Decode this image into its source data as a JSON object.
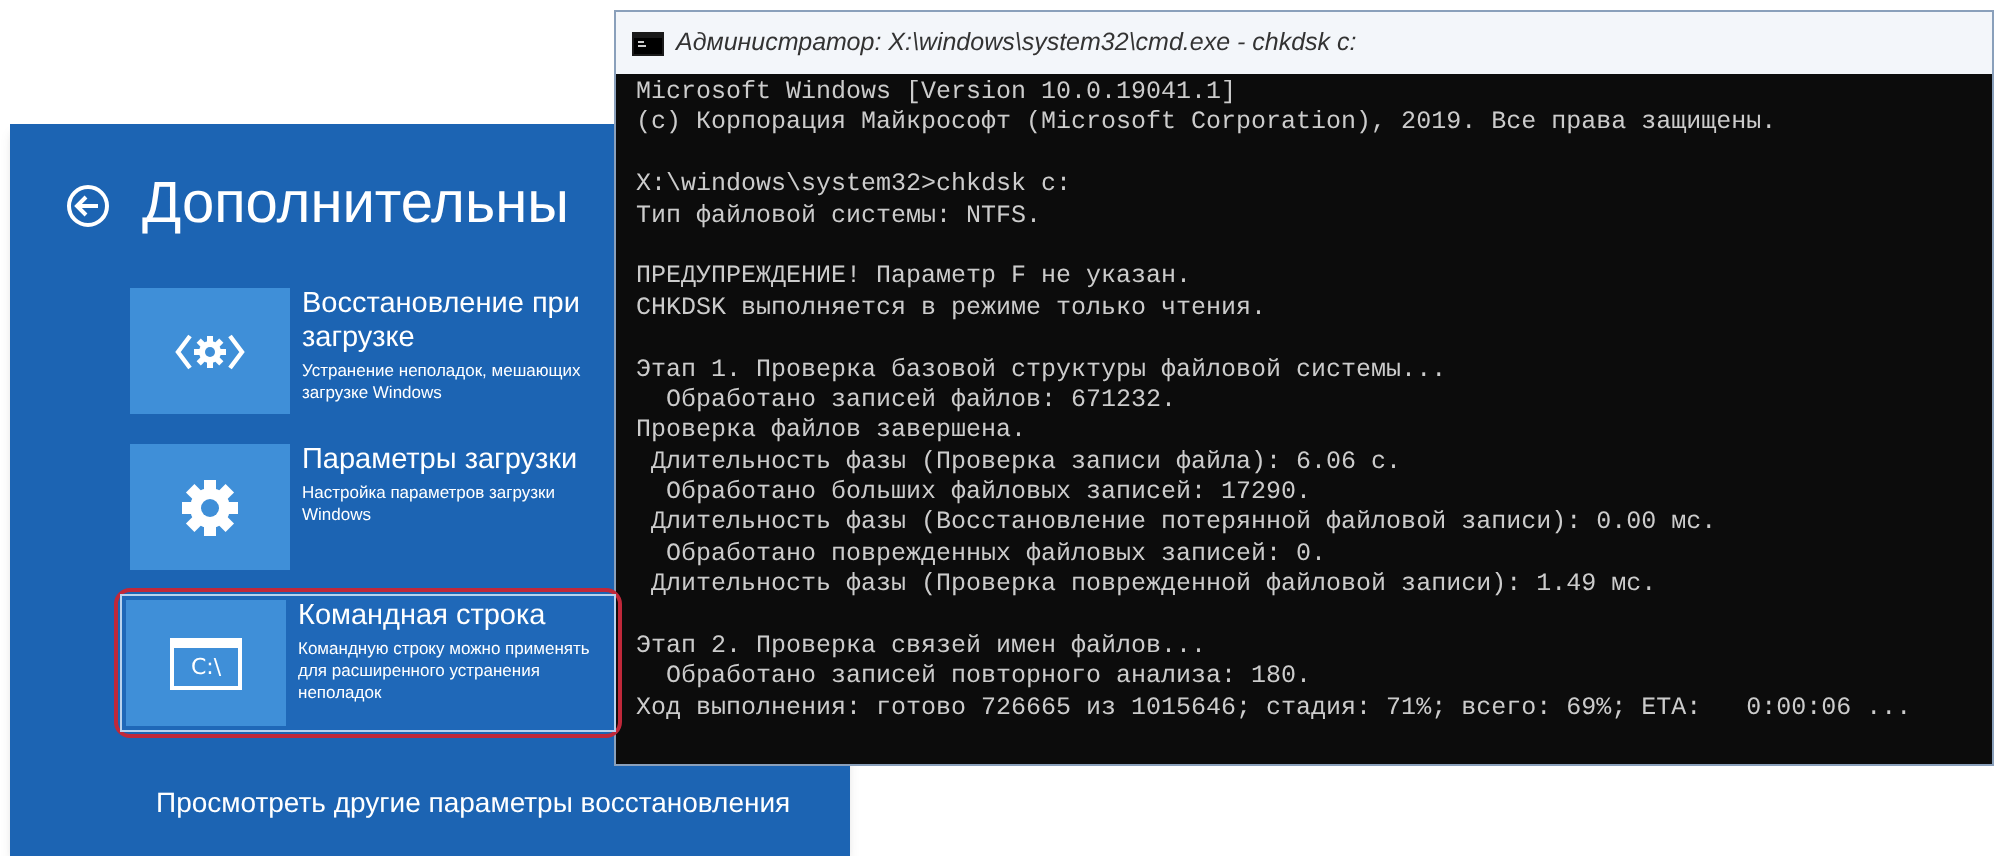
{
  "recovery_panel": {
    "heading": "Дополнительны",
    "options": [
      {
        "kind": "startup-repair",
        "title": "Восстановление при загрузке",
        "description": "Устранение неполадок, мешающих загрузке Windows",
        "selected": false
      },
      {
        "kind": "settings",
        "title": "Параметры загрузки",
        "description": "Настройка параметров загрузки Windows",
        "selected": false
      },
      {
        "kind": "command-prompt",
        "icon_label": "C:\\",
        "title": "Командная строка",
        "description": "Командную строку можно применять для расширенного устранения неполадок",
        "selected": true
      }
    ],
    "link": "Просмотреть другие параметры восстановления"
  },
  "console_window": {
    "title": "Администратор: X:\\windows\\system32\\cmd.exe - chkdsk  c:",
    "blocks": [
      [
        "Microsoft Windows [Version 10.0.19041.1]",
        "(c) Корпорация Майкрософт (Microsoft Corporation), 2019. Все права защищены."
      ],
      [
        "X:\\windows\\system32>chkdsk c:",
        "Тип файловой системы: NTFS."
      ],
      [
        "ПРЕДУПРЕЖДЕНИЕ! Параметр F не указан.",
        "CHKDSK выполняется в режиме только чтения."
      ],
      [
        "Этап 1. Проверка базовой структуры файловой системы...",
        "  Обработано записей файлов: 671232.",
        "Проверка файлов завершена.",
        " Длительность фазы (Проверка записи файла): 6.06 с.",
        "  Обработано больших файловых записей: 17290.",
        " Длительность фазы (Восстановление потерянной файловой записи): 0.00 мс.",
        "  Обработано поврежденных файловых записей: 0.",
        " Длительность фазы (Проверка поврежденной файловой записи): 1.49 мс."
      ],
      [
        "Этап 2. Проверка связей имен файлов...",
        "  Обработано записей повторного анализа: 180.",
        "Ход выполнения: готово 726665 из 1015646; стадия: 71%; всего: 69%; ETA:   0:00:06 ..."
      ]
    ]
  }
}
